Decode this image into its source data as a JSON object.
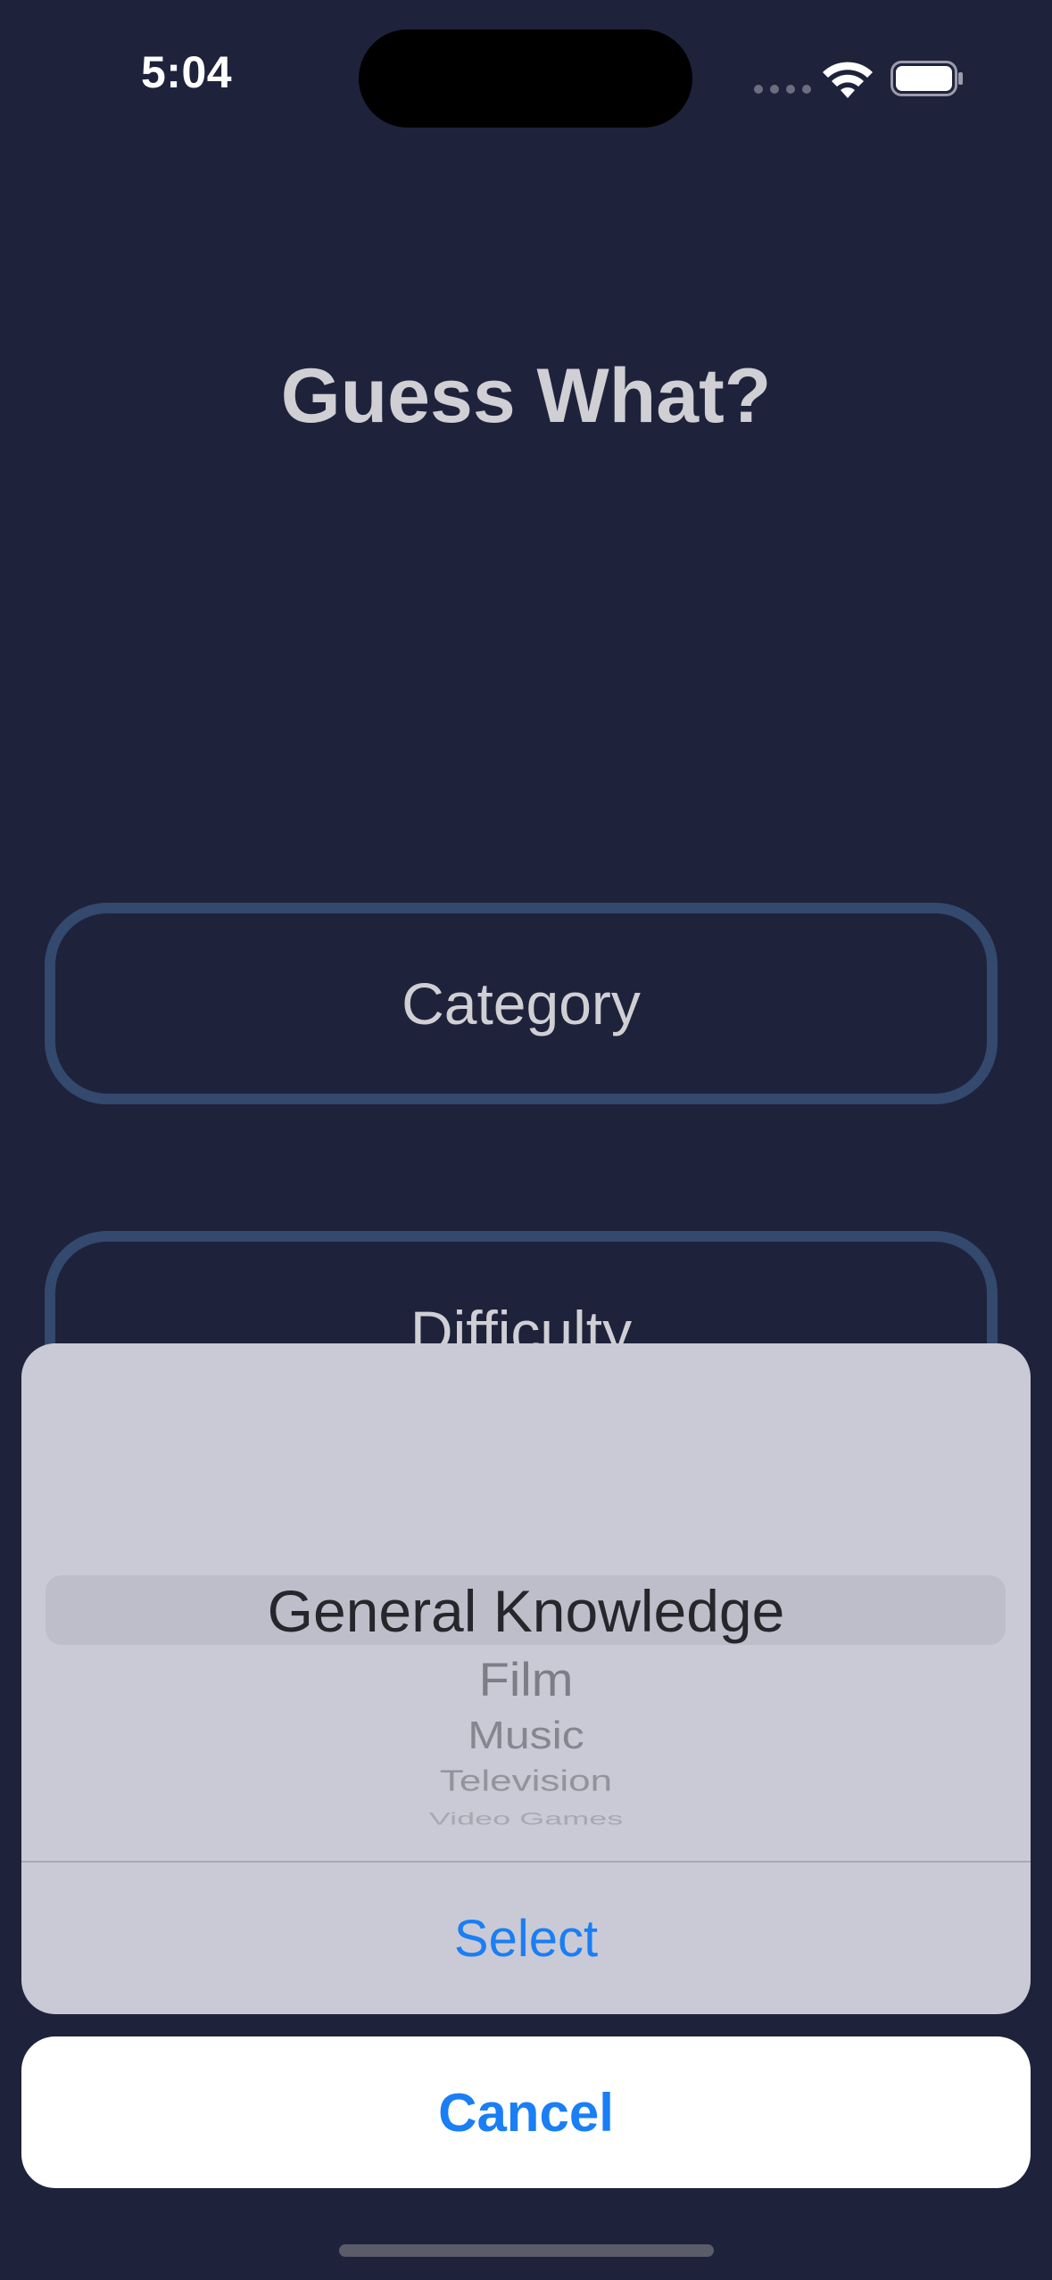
{
  "status_bar": {
    "time": "5:04"
  },
  "app": {
    "title": "Guess What?"
  },
  "buttons": {
    "category_label": "Category",
    "difficulty_label": "Difficulty"
  },
  "action_sheet": {
    "picker_options": [
      "General Knowledge",
      "Film",
      "Music",
      "Television",
      "Video Games"
    ],
    "selected_option": "General Knowledge",
    "select_label": "Select",
    "cancel_label": "Cancel"
  },
  "colors": {
    "background": "#1f223b",
    "button_border": "#33496e",
    "accent": "#1a7ef5",
    "sheet_background": "#c9cad5"
  }
}
